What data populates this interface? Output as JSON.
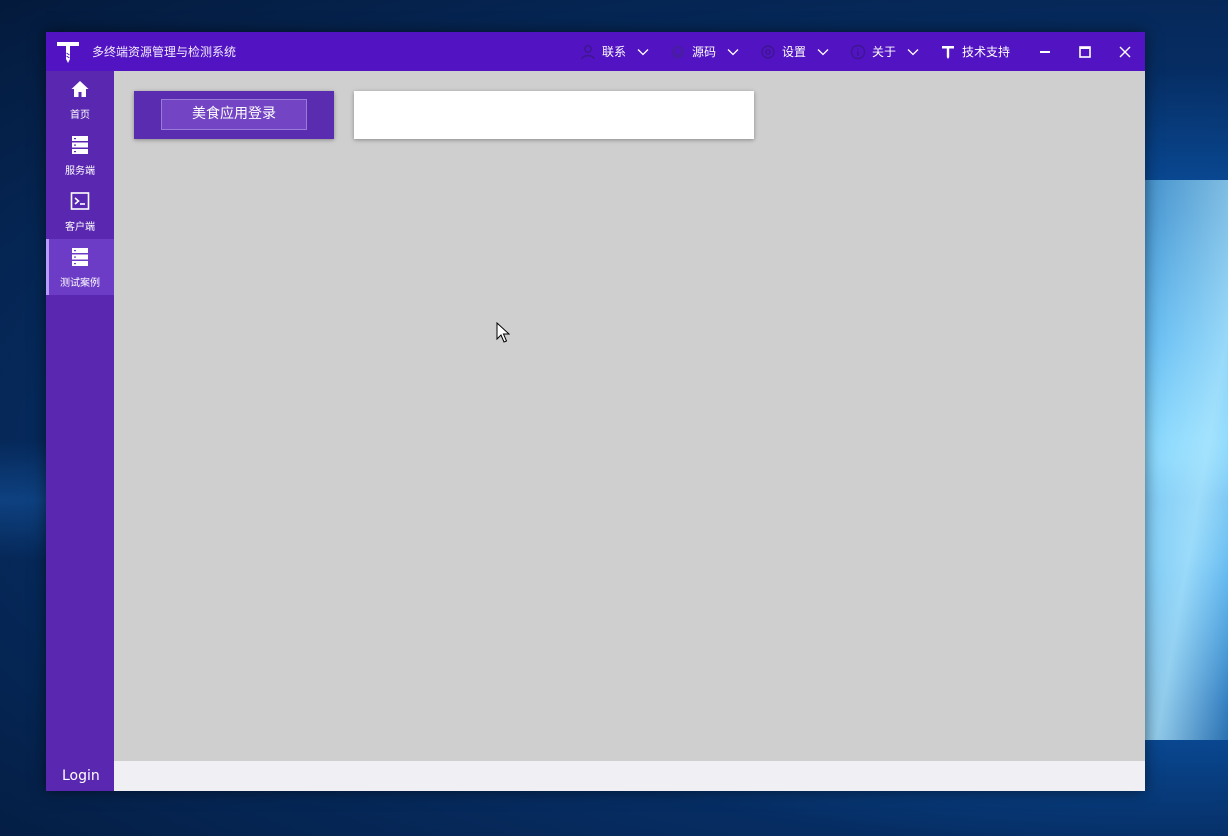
{
  "window": {
    "title": "多终端资源管理与检测系统",
    "accent_color": "#5213c2",
    "sidebar_color": "#5a28b0"
  },
  "menu": [
    {
      "label": "联系",
      "icon": "user-icon"
    },
    {
      "label": "源码",
      "icon": "github-icon"
    },
    {
      "label": "设置",
      "icon": "gear-icon"
    },
    {
      "label": "关于",
      "icon": "info-icon"
    },
    {
      "label": "技术支持",
      "icon": "tech-logo-icon"
    }
  ],
  "sidebar": {
    "items": [
      {
        "label": "首页",
        "icon": "home-icon"
      },
      {
        "label": "服务端",
        "icon": "server-icon"
      },
      {
        "label": "客户端",
        "icon": "terminal-icon"
      },
      {
        "label": "测试案例",
        "icon": "server-icon",
        "active": true
      }
    ],
    "login_label": "Login"
  },
  "main": {
    "test_button_label": "美食应用登录",
    "output_text": ""
  }
}
